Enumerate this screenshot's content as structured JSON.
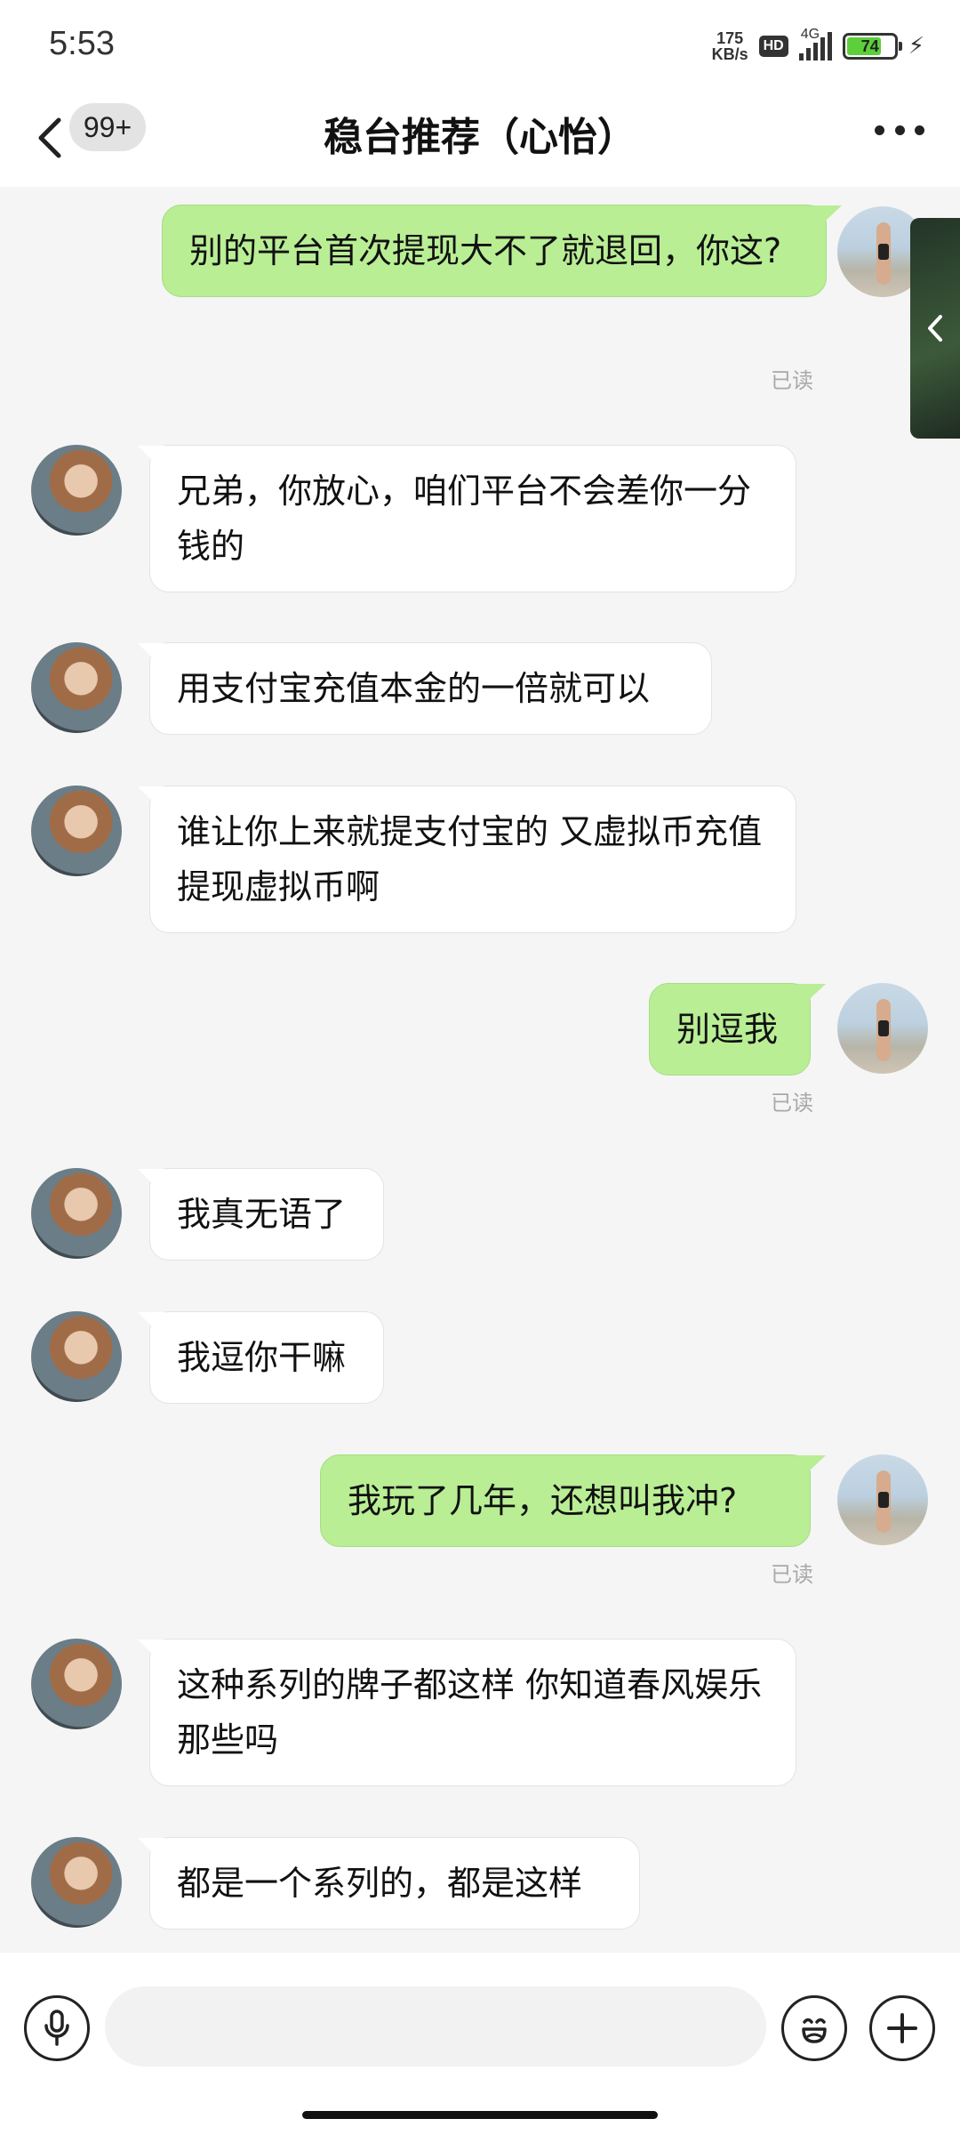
{
  "status_bar": {
    "time": "5:53",
    "net_speed_value": "175",
    "net_speed_unit": "KB/s",
    "hd_label": "HD",
    "network_label": "4G",
    "battery_level": "74"
  },
  "header": {
    "back_icon": "chevron-left-icon",
    "unread_count": "99+",
    "title": "稳台推荐（心怡）",
    "more_icon": "more-dots-icon"
  },
  "messages": [
    {
      "side": "out",
      "text": "别的平台首次提现大不了就退回，你这?",
      "status": "已读"
    },
    {
      "side": "in",
      "text": "兄弟，你放心，咱们平台不会差你一分钱的"
    },
    {
      "side": "in",
      "text": "用支付宝充值本金的一倍就可以"
    },
    {
      "side": "in",
      "text": "谁让你上来就提支付宝的 又虚拟币充值 提现虚拟币啊"
    },
    {
      "side": "out",
      "text": "别逗我",
      "status": "已读"
    },
    {
      "side": "in",
      "text": "我真无语了"
    },
    {
      "side": "in",
      "text": "我逗你干嘛"
    },
    {
      "side": "out",
      "text": "我玩了几年，还想叫我冲?",
      "status": "已读"
    },
    {
      "side": "in",
      "text": "这种系列的牌子都这样 你知道春风娱乐那些吗"
    },
    {
      "side": "in",
      "text": "都是一个系列的，都是这样"
    }
  ],
  "input_bar": {
    "voice_icon": "microphone-icon",
    "input_value": "",
    "emoji_icon": "emoji-icon",
    "plus_icon": "plus-icon"
  },
  "colors": {
    "outgoing_bubble": "#b9ee95",
    "incoming_bubble": "#ffffff",
    "background": "#f5f5f5"
  }
}
